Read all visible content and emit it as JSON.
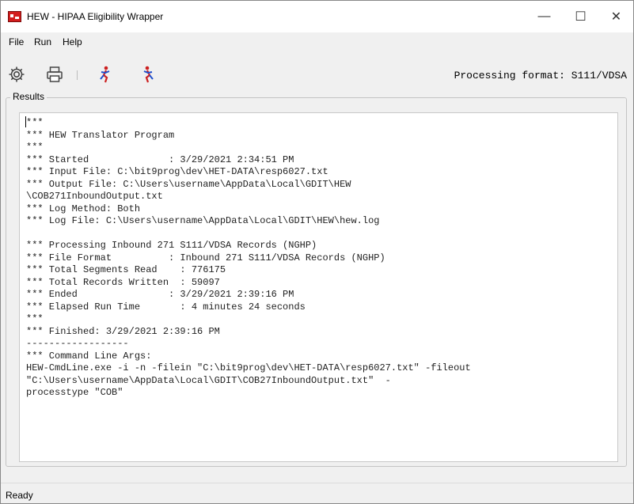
{
  "window": {
    "title": "HEW - HIPAA Eligibility Wrapper",
    "controls": {
      "minimize": "—",
      "maximize": "☐",
      "close": "✕"
    }
  },
  "menu": {
    "items": [
      "File",
      "Run",
      "Help"
    ]
  },
  "toolbar": {
    "icons": [
      "gear-icon",
      "printer-icon",
      "run-inbound-icon",
      "run-outbound-icon"
    ],
    "processing_format": "Processing format: S111/VDSA"
  },
  "results": {
    "label": "Results",
    "lines": [
      "***",
      "*** HEW Translator Program",
      "***",
      "*** Started              : 3/29/2021 2:34:51 PM",
      "*** Input File: C:\\bit9prog\\dev\\HET-DATA\\resp6027.txt",
      "*** Output File: C:\\Users\\username\\AppData\\Local\\GDIT\\HEW",
      "\\COB271InboundOutput.txt",
      "*** Log Method: Both",
      "*** Log File: C:\\Users\\username\\AppData\\Local\\GDIT\\HEW\\hew.log",
      "",
      "*** Processing Inbound 271 S111/VDSA Records (NGHP)",
      "*** File Format          : Inbound 271 S111/VDSA Records (NGHP)",
      "*** Total Segments Read    : 776175",
      "*** Total Records Written  : 59097",
      "*** Ended                : 3/29/2021 2:39:16 PM",
      "*** Elapsed Run Time       : 4 minutes 24 seconds",
      "***",
      "*** Finished: 3/29/2021 2:39:16 PM",
      "------------------",
      "*** Command Line Args:",
      "HEW-CmdLine.exe -i -n -filein \"C:\\bit9prog\\dev\\HET-DATA\\resp6027.txt\" -fileout",
      "\"C:\\Users\\username\\AppData\\Local\\GDIT\\COB27InboundOutput.txt\"  -",
      "processtype \"COB\""
    ]
  },
  "status": {
    "text": "Ready"
  },
  "colors": {
    "app_icon": "#d21d1d",
    "toolbar_red": "#cc1f1f",
    "toolbar_blue": "#1f4fcc"
  }
}
